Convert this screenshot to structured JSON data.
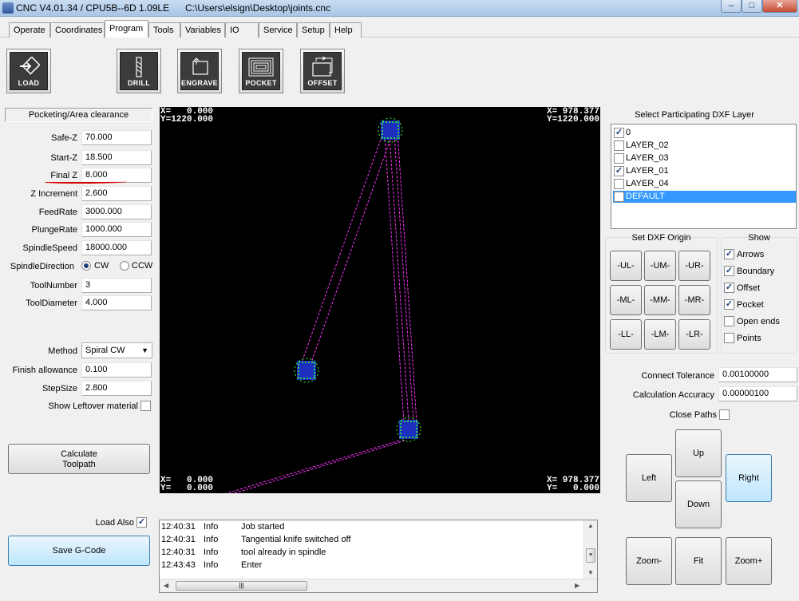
{
  "window": {
    "title": "CNC V4.01.34 / CPU5B--6D 1.09LE",
    "path": "C:\\Users\\elsign\\Desktop\\joints.cnc",
    "min_glyph": "–",
    "max_glyph": "□",
    "close_glyph": "✕"
  },
  "menu_tabs": [
    "Operate",
    "Coordinates",
    "Program",
    "Tools",
    "Variables",
    "IO",
    "Service",
    "Setup",
    "Help"
  ],
  "active_tab": "Program",
  "toolbar": {
    "load": "LOAD",
    "drill": "DRILL",
    "engrave": "ENGRAVE",
    "pocket": "POCKET",
    "offset": "OFFSET"
  },
  "params": {
    "group_title": "Pocketing/Area clearance",
    "safe_z": {
      "label": "Safe-Z",
      "value": "70.000"
    },
    "start_z": {
      "label": "Start-Z",
      "value": "18.500"
    },
    "final_z": {
      "label": "Final Z",
      "value": "8.000"
    },
    "z_increment": {
      "label": "Z Increment",
      "value": "2.600"
    },
    "feedrate": {
      "label": "FeedRate",
      "value": "3000.000"
    },
    "plungerate": {
      "label": "PlungeRate",
      "value": "1000.000"
    },
    "spindlespeed": {
      "label": "SpindleSpeed",
      "value": "18000.000"
    },
    "spindledirection": {
      "label": "SpindleDirection",
      "cw": "CW",
      "ccw": "CCW",
      "selected": "CW"
    },
    "toolnumber": {
      "label": "ToolNumber",
      "value": "3"
    },
    "tooldiameter": {
      "label": "ToolDiameter",
      "value": "4.000"
    },
    "method": {
      "label": "Method",
      "value": "Spiral CW"
    },
    "finish_allowance": {
      "label": "Finish allowance",
      "value": "0.100"
    },
    "stepsize": {
      "label": "StepSize",
      "value": "2.800"
    },
    "show_leftover": {
      "label": "Show Leftover material",
      "checked": false
    }
  },
  "calculate_button": {
    "line1": "Calculate",
    "line2": "Toolpath"
  },
  "load_also": {
    "label": "Load Also",
    "checked": true
  },
  "save_gcode_button": "Save G-Code",
  "canvas": {
    "top_left": "X=   0.000\nY=1220.000",
    "top_right": "X= 978.377\nY=1220.000",
    "bottom_left": "X=   0.000\nY=   0.000",
    "bottom_right": "X= 978.377\nY=   0.000",
    "path_color": "#ff33ff",
    "joint_color": "#33ff33"
  },
  "log": [
    {
      "time": "12:40:31",
      "level": "Info",
      "message": "Job started"
    },
    {
      "time": "12:40:31",
      "level": "Info",
      "message": "Tangential knife switched off"
    },
    {
      "time": "12:40:31",
      "level": "Info",
      "message": "tool already in spindle"
    },
    {
      "time": "12:43:43",
      "level": "Info",
      "message": "Enter"
    }
  ],
  "layers": {
    "title": "Select Participating DXF Layer",
    "items": [
      {
        "name": "0",
        "checked": true
      },
      {
        "name": "LAYER_02",
        "checked": false
      },
      {
        "name": "LAYER_03",
        "checked": false
      },
      {
        "name": "LAYER_01",
        "checked": true
      },
      {
        "name": "LAYER_04",
        "checked": false
      },
      {
        "name": "DEFAULT",
        "checked": false,
        "selected": true
      }
    ]
  },
  "dxf_origin": {
    "title": "Set DXF Origin",
    "buttons": [
      "-UL-",
      "-UM-",
      "-UR-",
      "-ML-",
      "-MM-",
      "-MR-",
      "-LL-",
      "-LM-",
      "-LR-"
    ]
  },
  "show": {
    "title": "Show",
    "items": [
      {
        "label": "Arrows",
        "checked": true
      },
      {
        "label": "Boundary",
        "checked": true
      },
      {
        "label": "Offset",
        "checked": true
      },
      {
        "label": "Pocket",
        "checked": true
      },
      {
        "label": "Open ends",
        "checked": false
      },
      {
        "label": "Points",
        "checked": false
      }
    ]
  },
  "connect_tolerance": {
    "label": "Connect Tolerance",
    "value": "0.00100000"
  },
  "calc_accuracy": {
    "label": "Calculation Accuracy",
    "value": "0.00000100"
  },
  "close_paths": {
    "label": "Close Paths",
    "checked": false
  },
  "jog": {
    "up": "Up",
    "down": "Down",
    "left": "Left",
    "right": "Right",
    "zoom_minus": "Zoom-",
    "fit": "Fit",
    "zoom_plus": "Zoom+"
  }
}
